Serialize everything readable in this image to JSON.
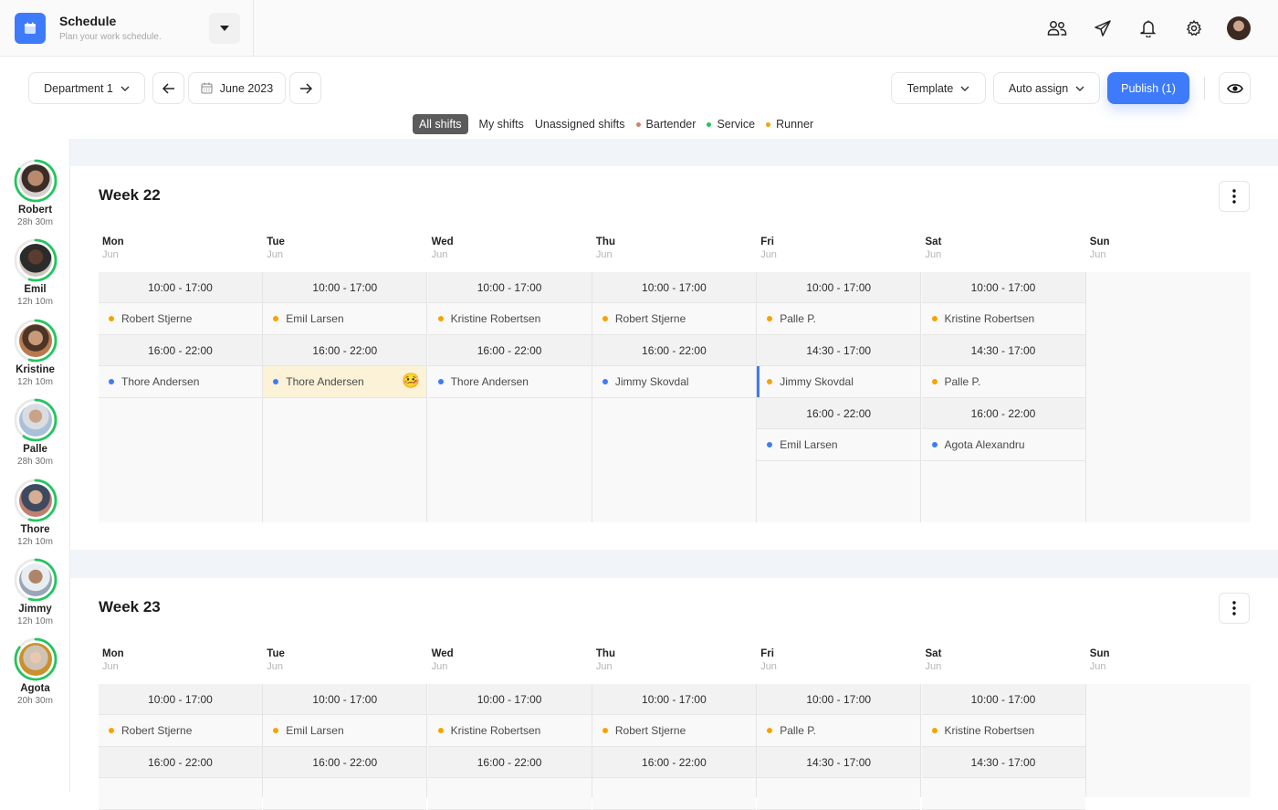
{
  "app": {
    "title": "Schedule",
    "subtitle": "Plan your work schedule."
  },
  "topbar": {
    "icons": [
      "users-icon",
      "send-icon",
      "bell-icon",
      "gear-icon",
      "user-avatar"
    ]
  },
  "toolbar": {
    "department": "Department 1",
    "month": "June 2023",
    "template_label": "Template",
    "auto_assign_label": "Auto assign",
    "publish_label": "Publish (1)"
  },
  "filters": [
    {
      "label": "All shifts",
      "active": true
    },
    {
      "label": "My shifts"
    },
    {
      "label": "Unassigned shifts"
    },
    {
      "label": "Bartender",
      "color": "#c8876a"
    },
    {
      "label": "Service",
      "color": "#22c55e"
    },
    {
      "label": "Runner",
      "color": "#f5a300"
    }
  ],
  "colors": {
    "accent": "#3e7bfa",
    "runner": "#f5a300",
    "service_blue": "#3e7bfa",
    "ring": "#22c55e",
    "highlight": "#fbf2d8"
  },
  "employees": [
    {
      "name": "Robert",
      "hours": "28h 30m",
      "progress": 0.85
    },
    {
      "name": "Emil",
      "hours": "12h 10m",
      "progress": 0.55
    },
    {
      "name": "Kristine",
      "hours": "12h 10m",
      "progress": 0.55
    },
    {
      "name": "Palle",
      "hours": "28h 30m",
      "progress": 0.6
    },
    {
      "name": "Thore",
      "hours": "12h 10m",
      "progress": 0.55
    },
    {
      "name": "Jimmy",
      "hours": "12h 10m",
      "progress": 0.55
    },
    {
      "name": "Agota",
      "hours": "20h 30m",
      "progress": 0.85
    }
  ],
  "weeks": [
    {
      "title": "Week 22",
      "days": [
        {
          "name": "Mon",
          "month": "Jun",
          "shifts": [
            {
              "time": "10:00 - 17:00",
              "person": "Robert Stjerne",
              "color": "#f5a300"
            },
            {
              "time": "16:00 - 22:00",
              "person": "Thore Andersen",
              "color": "#3e7bfa"
            }
          ]
        },
        {
          "name": "Tue",
          "month": "Jun",
          "shifts": [
            {
              "time": "10:00 - 17:00",
              "person": "Emil Larsen",
              "color": "#f5a300"
            },
            {
              "time": "16:00 - 22:00",
              "person": "Thore Andersen",
              "color": "#3e7bfa",
              "highlight": true,
              "emoji": "🤒"
            }
          ]
        },
        {
          "name": "Wed",
          "month": "Jun",
          "shifts": [
            {
              "time": "10:00 - 17:00",
              "person": "Kristine Robertsen",
              "color": "#f5a300"
            },
            {
              "time": "16:00 - 22:00",
              "person": "Thore Andersen",
              "color": "#3e7bfa"
            }
          ]
        },
        {
          "name": "Thu",
          "month": "Jun",
          "shifts": [
            {
              "time": "10:00 - 17:00",
              "person": "Robert Stjerne",
              "color": "#f5a300"
            },
            {
              "time": "16:00 - 22:00",
              "person": "Jimmy Skovdal",
              "color": "#3e7bfa"
            }
          ]
        },
        {
          "name": "Fri",
          "month": "Jun",
          "shifts": [
            {
              "time": "10:00 - 17:00",
              "person": "Palle P.",
              "color": "#f5a300"
            },
            {
              "time": "14:30 - 17:00",
              "person": "Jimmy Skovdal",
              "color": "#f5a300",
              "selected": true
            },
            {
              "time": "16:00 - 22:00",
              "person": "Emil Larsen",
              "color": "#3e7bfa"
            }
          ]
        },
        {
          "name": "Sat",
          "month": "Jun",
          "shifts": [
            {
              "time": "10:00 - 17:00",
              "person": "Kristine Robertsen",
              "color": "#f5a300"
            },
            {
              "time": "14:30 - 17:00",
              "person": "Palle P.",
              "color": "#f5a300"
            },
            {
              "time": "16:00 - 22:00",
              "person": "Agota Alexandru",
              "color": "#3e7bfa"
            }
          ]
        },
        {
          "name": "Sun",
          "month": "Jun",
          "shifts": []
        }
      ]
    },
    {
      "title": "Week 23",
      "days": [
        {
          "name": "Mon",
          "month": "Jun",
          "shifts": [
            {
              "time": "10:00 - 17:00",
              "person": "Robert Stjerne",
              "color": "#f5a300"
            },
            {
              "time": "16:00 - 22:00",
              "person": "",
              "color": ""
            }
          ]
        },
        {
          "name": "Tue",
          "month": "Jun",
          "shifts": [
            {
              "time": "10:00 - 17:00",
              "person": "Emil Larsen",
              "color": "#f5a300"
            },
            {
              "time": "16:00 - 22:00",
              "person": "",
              "color": ""
            }
          ]
        },
        {
          "name": "Wed",
          "month": "Jun",
          "shifts": [
            {
              "time": "10:00 - 17:00",
              "person": "Kristine Robertsen",
              "color": "#f5a300"
            },
            {
              "time": "16:00 - 22:00",
              "person": "",
              "color": ""
            }
          ]
        },
        {
          "name": "Thu",
          "month": "Jun",
          "shifts": [
            {
              "time": "10:00 - 17:00",
              "person": "Robert Stjerne",
              "color": "#f5a300"
            },
            {
              "time": "16:00 - 22:00",
              "person": "",
              "color": ""
            }
          ]
        },
        {
          "name": "Fri",
          "month": "Jun",
          "shifts": [
            {
              "time": "10:00 - 17:00",
              "person": "Palle P.",
              "color": "#f5a300"
            },
            {
              "time": "14:30 - 17:00",
              "person": "",
              "color": ""
            }
          ]
        },
        {
          "name": "Sat",
          "month": "Jun",
          "shifts": [
            {
              "time": "10:00 - 17:00",
              "person": "Kristine Robertsen",
              "color": "#f5a300"
            },
            {
              "time": "14:30 - 17:00",
              "person": "",
              "color": ""
            }
          ]
        },
        {
          "name": "Sun",
          "month": "Jun",
          "shifts": []
        }
      ]
    }
  ]
}
